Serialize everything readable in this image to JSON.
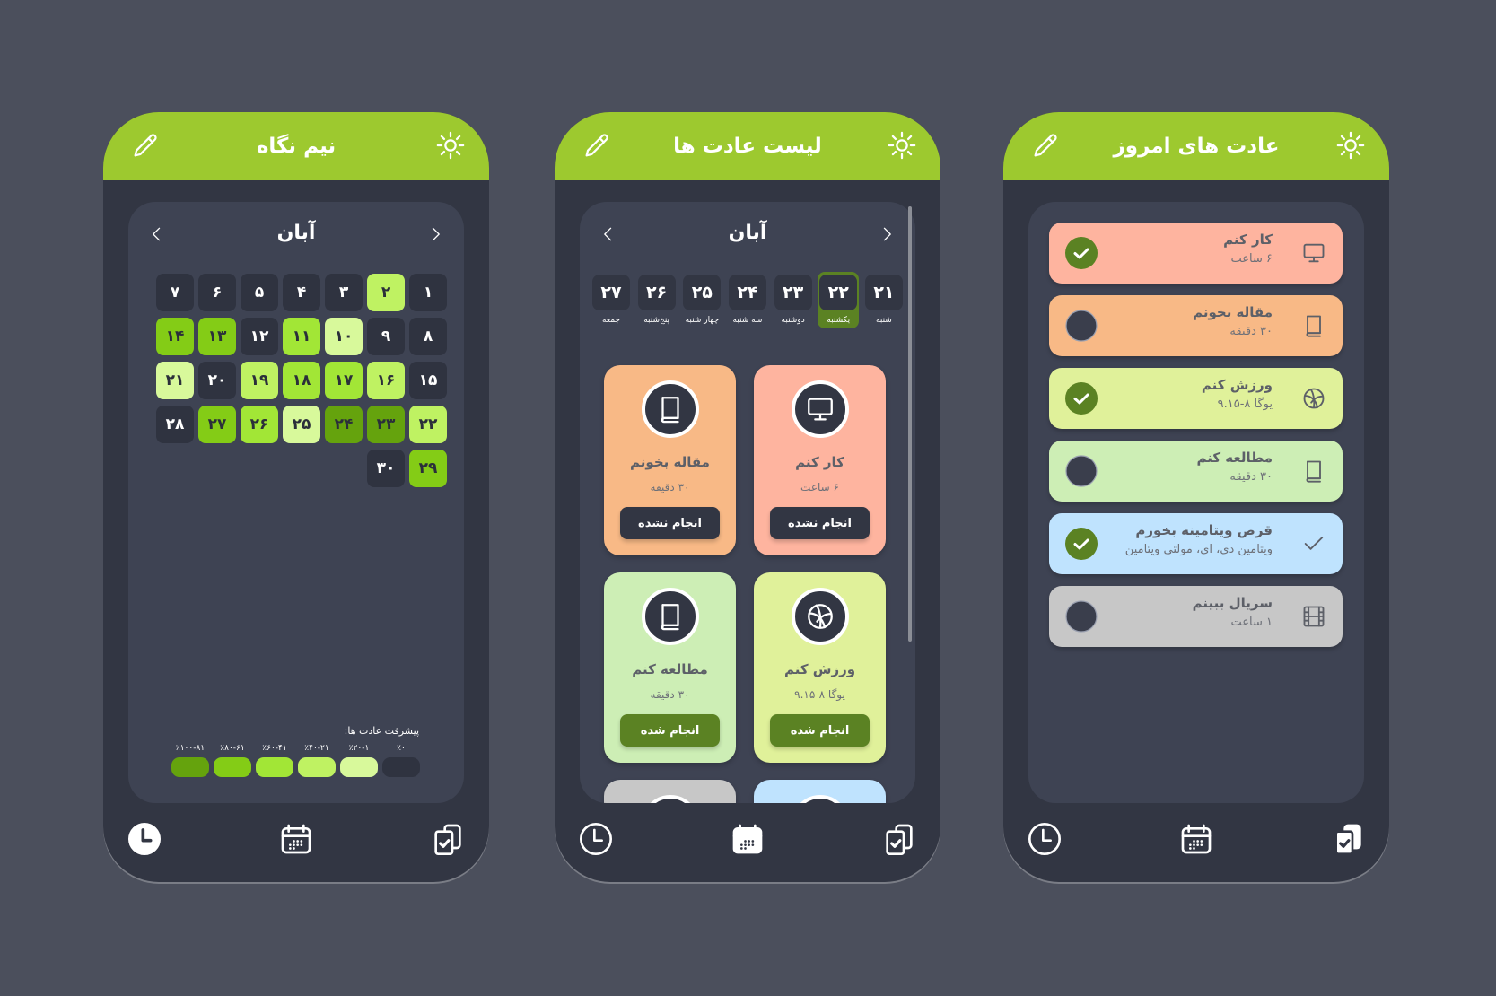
{
  "colors": {
    "header": "#9dc92f",
    "frame": "#323643",
    "panel": "#3e4353",
    "done": "#5b8223",
    "levels": [
      "#2f3340",
      "#d8f99b",
      "#bff262",
      "#a2e636",
      "#84cc16",
      "#65a30d"
    ]
  },
  "overview": {
    "title": "نیم نگاه",
    "month": "آبان",
    "days": [
      {
        "d": "۱",
        "level": 0
      },
      {
        "d": "۲",
        "level": 2
      },
      {
        "d": "۳",
        "level": 0
      },
      {
        "d": "۴",
        "level": 0
      },
      {
        "d": "۵",
        "level": 0
      },
      {
        "d": "۶",
        "level": 0
      },
      {
        "d": "۷",
        "level": 0
      },
      {
        "d": "۸",
        "level": 0
      },
      {
        "d": "۹",
        "level": 0
      },
      {
        "d": "۱۰",
        "level": 1
      },
      {
        "d": "۱۱",
        "level": 3
      },
      {
        "d": "۱۲",
        "level": 0
      },
      {
        "d": "۱۳",
        "level": 4
      },
      {
        "d": "۱۴",
        "level": 4
      },
      {
        "d": "۱۵",
        "level": 0
      },
      {
        "d": "۱۶",
        "level": 2
      },
      {
        "d": "۱۷",
        "level": 3
      },
      {
        "d": "۱۸",
        "level": 3
      },
      {
        "d": "۱۹",
        "level": 2
      },
      {
        "d": "۲۰",
        "level": 0
      },
      {
        "d": "۲۱",
        "level": 1
      },
      {
        "d": "۲۲",
        "level": 2
      },
      {
        "d": "۲۳",
        "level": 5
      },
      {
        "d": "۲۴",
        "level": 5
      },
      {
        "d": "۲۵",
        "level": 1
      },
      {
        "d": "۲۶",
        "level": 3
      },
      {
        "d": "۲۷",
        "level": 4
      },
      {
        "d": "۲۸",
        "level": 0
      },
      {
        "d": "۲۹",
        "level": 4
      },
      {
        "d": "۳۰",
        "level": 0
      }
    ],
    "legend_title": "پیشرفت عادت ها:",
    "legend": [
      {
        "label": "٪۰",
        "level": 0
      },
      {
        "label": "٪۲۰-۱",
        "level": 1
      },
      {
        "label": "٪۴۰-۲۱",
        "level": 2
      },
      {
        "label": "٪۶۰-۴۱",
        "level": 3
      },
      {
        "label": "٪۸۰-۶۱",
        "level": 4
      },
      {
        "label": "٪۱۰۰-۸۱",
        "level": 5
      }
    ],
    "active_nav": "clock"
  },
  "habits": {
    "title": "لیست عادت ها",
    "month": "آبان",
    "week": [
      {
        "n": "۲۱",
        "name": "شنبه",
        "selected": false
      },
      {
        "n": "۲۲",
        "name": "یکشنبه",
        "selected": true
      },
      {
        "n": "۲۳",
        "name": "دوشنبه",
        "selected": false
      },
      {
        "n": "۲۴",
        "name": "سه شنبه",
        "selected": false
      },
      {
        "n": "۲۵",
        "name": "چهار شنبه",
        "selected": false
      },
      {
        "n": "۲۶",
        "name": "پنج‌شنبه",
        "selected": false
      },
      {
        "n": "۲۷",
        "name": "جمعه",
        "selected": false
      }
    ],
    "cards": [
      {
        "title": "کار کنم",
        "sub": "۶ ساعت",
        "icon": "monitor-icon",
        "color": "#feb49f",
        "button": "انجام نشده",
        "done": false
      },
      {
        "title": "مقاله بخونم",
        "sub": "۳۰ دقیقه",
        "icon": "book-icon",
        "color": "#f8b986",
        "button": "انجام نشده",
        "done": false
      },
      {
        "title": "ورزش کنم",
        "sub": "یوگا ۸-۹.۱۵",
        "icon": "basketball-icon",
        "color": "#e0f19a",
        "button": "انجام شده",
        "done": true
      },
      {
        "title": "مطالعه کنم",
        "sub": "۳۰ دقیقه",
        "icon": "book-icon",
        "color": "#cdeeb5",
        "button": "انجام شده",
        "done": true
      },
      {
        "color": "#bfe3fe",
        "icon": "check-icon",
        "partial": true
      },
      {
        "color": "#c7c7c7",
        "icon": "film-icon",
        "partial": true
      }
    ],
    "active_nav": "calendar"
  },
  "today": {
    "title": "عادت های امروز",
    "items": [
      {
        "title": "کار کنم",
        "sub": "۶ ساعت",
        "icon": "monitor-icon",
        "color": "#feb49f",
        "done": true
      },
      {
        "title": "مقاله بخونم",
        "sub": "۳۰ دقیقه",
        "icon": "book-icon",
        "color": "#f8b986",
        "done": false
      },
      {
        "title": "ورزش کنم",
        "sub": "یوگا ۸-۹.۱۵",
        "icon": "basketball-icon",
        "color": "#e0f19a",
        "done": true
      },
      {
        "title": "مطالعه کنم",
        "sub": "۳۰ دقیقه",
        "icon": "book-icon",
        "color": "#cdeeb5",
        "done": false
      },
      {
        "title": "قرص ویتامینه بخورم",
        "sub": "ویتامین دی، ای، مولتی ویتامین",
        "icon": "check-icon",
        "color": "#bfe3fe",
        "done": true
      },
      {
        "title": "سریال ببینم",
        "sub": "۱ ساعت",
        "icon": "film-icon",
        "color": "#c7c7c7",
        "done": false
      }
    ],
    "active_nav": "clipboard"
  }
}
